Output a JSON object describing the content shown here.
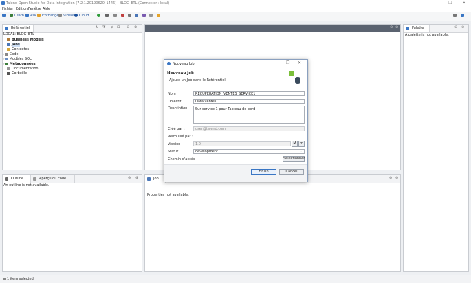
{
  "window": {
    "title": "Talend Open Studio for Data Integration (7.2.1.20190620_1446) | BLOG_ETL (Connexion: local)",
    "controls": {
      "minimize": "—",
      "maximize": "❐",
      "close": "✕"
    }
  },
  "menu": [
    "Fichier",
    "Edition",
    "Fenêtre",
    "Aide"
  ],
  "toolbar": {
    "links": [
      "Learn",
      "Ask",
      "Exchange",
      "Videos",
      "Cloud"
    ],
    "colors": {
      "link": "#1a4f9c"
    }
  },
  "repository": {
    "tab_label": "Référentiel",
    "root": "LOCAL: BLOG_ETL",
    "items": [
      {
        "label": "Business Models",
        "bold": true,
        "icon": "business-model-icon"
      },
      {
        "label": "Jobs",
        "bold": true,
        "icon": "jobs-icon"
      },
      {
        "label": "Contextes",
        "bold": false,
        "icon": "contexts-icon"
      },
      {
        "label": "Code",
        "bold": false,
        "icon": "code-icon"
      },
      {
        "label": "Modèles SQL",
        "bold": false,
        "icon": "sql-icon"
      },
      {
        "label": "Métadonnées",
        "bold": true,
        "icon": "metadata-icon"
      },
      {
        "label": "Documentation",
        "bold": false,
        "icon": "doc-icon"
      },
      {
        "label": "Corbeille",
        "bold": false,
        "icon": "trash-icon"
      }
    ]
  },
  "palette": {
    "tab_label": "Palette",
    "message": "A palette is not available."
  },
  "outline": {
    "tab_label": "Outline",
    "tab2_label": "Aperçu du code",
    "message": "An outline is not available."
  },
  "job_panel": {
    "tab_label": "Job",
    "message": "Properties not available."
  },
  "statusbar": {
    "text": "1 item selected"
  },
  "dialog": {
    "title": "Nouveau Job",
    "heading": "Nouveau Job",
    "subheading": "Ajoute un Job dans le Référentiel",
    "fields": {
      "nom_label": "Nom",
      "nom_value": "RECUPERATION_VENTES_SERVICE1",
      "objectif_label": "Objectif",
      "objectif_value": "Data ventes",
      "description_label": "Description",
      "description_value": "Sur service 1 pour Tableau de bord",
      "cree_par_label": "Créé par :",
      "cree_par_value": "user@talend.com",
      "verrouille_label": "Verrouillé par :",
      "version_label": "Version",
      "version_value": "1.0",
      "version_major": "M",
      "version_minor": "m",
      "statut_label": "Statut",
      "statut_value": "development",
      "chemin_label": "Chemin d'accès",
      "chemin_button": "Sélectionner"
    },
    "buttons": {
      "finish": "Finish",
      "cancel": "Cancel"
    }
  }
}
